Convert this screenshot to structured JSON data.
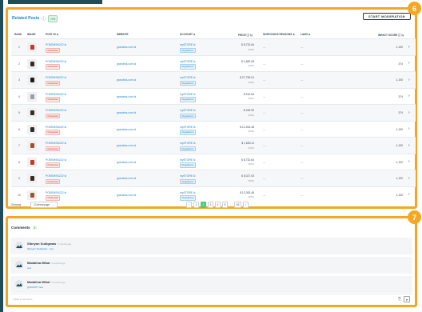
{
  "related_posts": {
    "title": "Related Posts",
    "badge": "ON",
    "start_button": "START MODERATION",
    "columns": {
      "rank": "RANK",
      "image": "IMAGE",
      "post_id": "POST ID",
      "website": "WEBSITE",
      "account": "ACCOUNT",
      "price": "PRICE",
      "suspicious": "SUSPICIOUS REASONS",
      "lang": "LANG",
      "impact": "IMPACT SCORE"
    },
    "rows": [
      {
        "rank": "1",
        "post_id": "POKEMSN222",
        "post_badge": "Moderated",
        "website": "grandma.com",
        "account": "mySTORE",
        "account_badge": "Regulations",
        "price": "$ 8,732.64",
        "price_sub": "(50%)",
        "suspicious": "—",
        "lang": "—",
        "impact": "1,100",
        "thumb_color": "#c0392b"
      },
      {
        "rank": "2",
        "post_id": "POKEMSN222",
        "post_badge": "Moderated",
        "website": "grandma.com",
        "account": "mySTORE",
        "account_badge": "Regulations",
        "price": "$ 1,890.05",
        "price_sub": "(50%)",
        "suspicious": "—",
        "lang": "—",
        "impact": "374",
        "thumb_color": "#3d2b1f"
      },
      {
        "rank": "3",
        "post_id": "POKEMSN222",
        "post_badge": "Moderated",
        "website": "grandma.com",
        "account": "mySTORE",
        "account_badge": "Regulations",
        "price": "$ 27,795.01",
        "price_sub": "(50%)",
        "suspicious": "—",
        "lang": "—",
        "impact": "1,100",
        "thumb_color": "#1c1c1c"
      },
      {
        "rank": "4",
        "post_id": "POKEMSN222",
        "post_badge": "Moderated",
        "website": "grandma.com",
        "account": "mySTORE",
        "account_badge": "Regulations",
        "price": "$ 510.84",
        "price_sub": "(50%)",
        "suspicious": "—",
        "lang": "—",
        "impact": "374",
        "thumb_color": "#9aa0a6"
      },
      {
        "rank": "5",
        "post_id": "POKEMSN222",
        "post_badge": "Moderated",
        "website": "grandma.com",
        "account": "mySTORE",
        "account_badge": "Regulations",
        "price": "$ 249.90",
        "price_sub": "(50%)",
        "suspicious": "—",
        "lang": "—",
        "impact": "374",
        "thumb_color": "#3d2b1f"
      },
      {
        "rank": "6",
        "post_id": "POKEMSN222",
        "post_badge": "Moderated",
        "website": "grandma.com",
        "account": "mySTORE",
        "account_badge": "Regulations",
        "price": "$ 12,263.48",
        "price_sub": "(50%)",
        "suspicious": "—",
        "lang": "—",
        "impact": "1,100",
        "thumb_color": "#2b2b2b"
      },
      {
        "rank": "7",
        "post_id": "POKEMSN222",
        "post_badge": "Moderated",
        "website": "grandma.com",
        "account": "mySTORE",
        "account_badge": "Regulations",
        "price": "$ 1,653.11",
        "price_sub": "(50%)",
        "suspicious": "—",
        "lang": "—",
        "impact": "1,100",
        "thumb_color": "#a0522d"
      },
      {
        "rank": "8",
        "post_id": "POKEMSN222",
        "post_badge": "Moderated",
        "website": "grandma.com",
        "account": "mySTORE",
        "account_badge": "Regulations",
        "price": "$ 8,732.64",
        "price_sub": "(50%)",
        "suspicious": "—",
        "lang": "—",
        "impact": "1,100",
        "thumb_color": "#c0392b"
      },
      {
        "rank": "9",
        "post_id": "POKEMSN222",
        "post_badge": "Moderated",
        "website": "grandma.com",
        "account": "mySTORE",
        "account_badge": "Regulations",
        "price": "$ 5,027.03",
        "price_sub": "(50%)",
        "suspicious": "—",
        "lang": "—",
        "impact": "1,100",
        "thumb_color": "#3d2b1f"
      },
      {
        "rank": "10",
        "post_id": "POKEMSN222",
        "post_badge": "Moderated",
        "website": "grandma.com",
        "account": "mySTORE",
        "account_badge": "Regulations",
        "price": "$ 12,263.48",
        "price_sub": "(50%)",
        "suspicious": "—",
        "lang": "—",
        "impact": "1,100",
        "thumb_color": "#a0522d"
      }
    ],
    "footer": {
      "showing_label": "Showing",
      "per_page": "10 items/page",
      "pages": [
        "1",
        "2",
        "3",
        "4",
        "5"
      ],
      "active_page": "2",
      "ellipsis": "...",
      "last_page": "49",
      "prev_icon": "‹",
      "next_icon": "›"
    },
    "marker": "6"
  },
  "comments": {
    "title": "Comments",
    "count": "3",
    "marker": "7",
    "items": [
      {
        "name": "Sibnyan Sudigwaw",
        "time": "2 months ago",
        "text": "Sibnyan Sudigwaw · test"
      },
      {
        "name": "Madalina Mihai",
        "time": "2 months ago",
        "text": "test"
      },
      {
        "name": "Madalina Mihai",
        "time": "2 months ago",
        "text": "@SUMITT test"
      }
    ],
    "input_placeholder": "Write a comment...",
    "attach_icon": "paperclip-icon",
    "send_icon": "send-icon"
  },
  "colors": {
    "accent": "#f5a623",
    "link": "#1e88c8",
    "active_page": "#4ccb7a"
  }
}
